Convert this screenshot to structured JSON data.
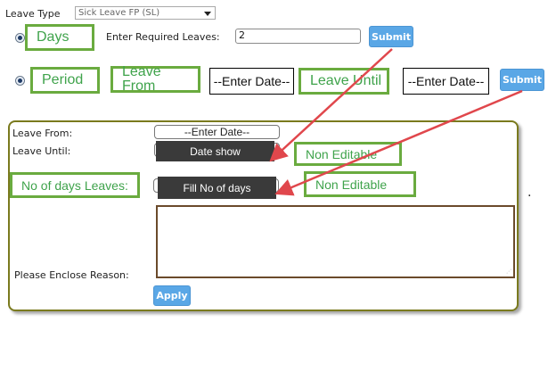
{
  "form": {
    "leave_type_label": "Leave Type",
    "leave_type_value": "Sick Leave FP (SL)",
    "enter_required_label": "Enter Required Leaves:",
    "required_leaves_value": "2",
    "submit_label": "Submit"
  },
  "annotations": {
    "days": "Days",
    "period": "Period",
    "leave_from": "Leave From",
    "leave_until": "Leave Until",
    "no_of_days_leaves": "No of days Leaves:",
    "non_editable": "Non Editable"
  },
  "date_placeholder": "--Enter Date--",
  "panel": {
    "leave_from_label": "Leave From:",
    "leave_until_label": "Leave Until:",
    "enter_date": "--Enter Date--",
    "date_show": "Date show",
    "fill_no_of_days": "Fill No of days",
    "enclose_reason_label": "Please Enclose Reason:",
    "apply_label": "Apply"
  },
  "colors": {
    "annotation_green": "#6aab3f",
    "arrow_red": "#e0474c",
    "button_blue": "#5aa7e6",
    "panel_border": "#7a7a1e"
  }
}
